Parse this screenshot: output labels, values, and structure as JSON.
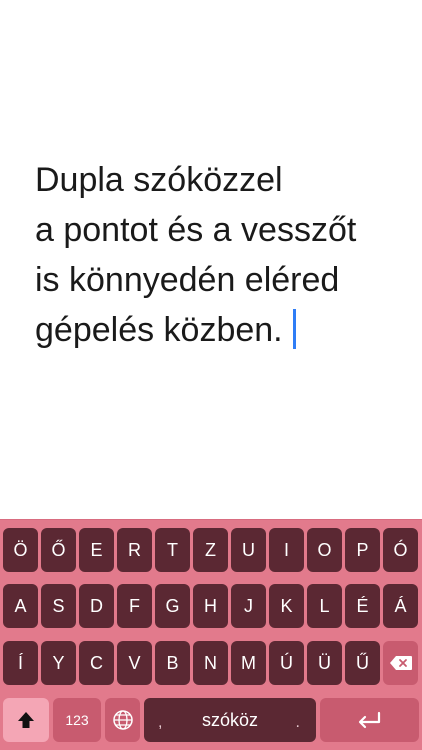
{
  "editor": {
    "lines": [
      "Dupla szóközzel",
      "a pontot és a vesszőt",
      "is könnyedén eléred",
      "gépelés közben."
    ]
  },
  "keyboard": {
    "row1": [
      "Ö",
      "Ő",
      "E",
      "R",
      "T",
      "Z",
      "U",
      "I",
      "O",
      "P",
      "Ó"
    ],
    "row2": [
      "A",
      "S",
      "D",
      "F",
      "G",
      "H",
      "J",
      "K",
      "L",
      "É",
      "Á"
    ],
    "row3": [
      "Í",
      "Y",
      "C",
      "V",
      "B",
      "N",
      "M",
      "Ú",
      "Ü",
      "Ű"
    ],
    "numbers_label": "123",
    "space_label": "szóköz",
    "space_comma": ",",
    "space_dot": ".",
    "icons": {
      "shift": "shift-arrow-icon",
      "delete": "backspace-icon",
      "globe": "globe-icon",
      "return": "return-arrow-icon"
    },
    "colors": {
      "background": "#e27a8c",
      "letter_key": "#5b2833",
      "function_key": "#c85b6f",
      "shift_active": "#f4a6b5",
      "cursor": "#2f7df6"
    }
  }
}
